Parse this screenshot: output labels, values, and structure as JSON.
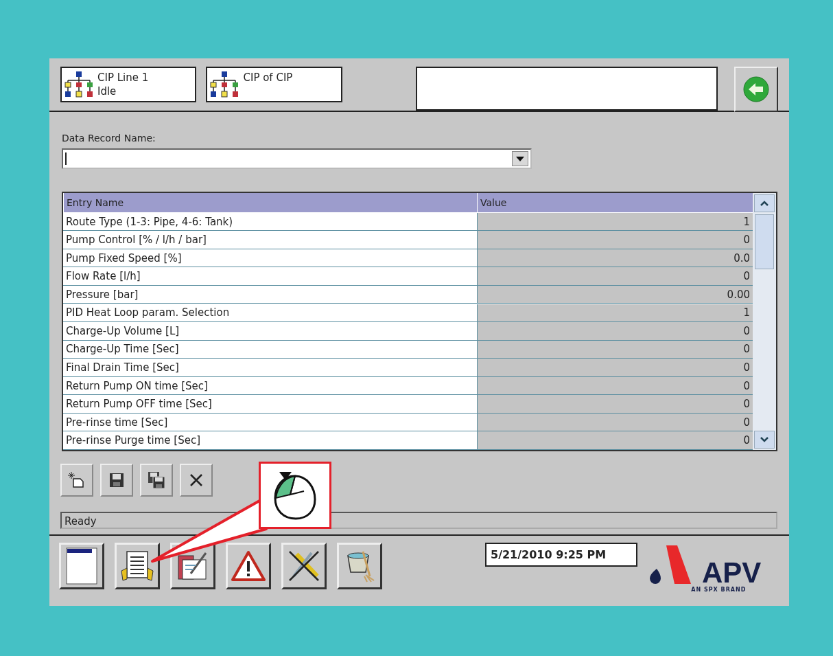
{
  "units": [
    {
      "title": "CIP Line 1",
      "status": "Idle"
    },
    {
      "title": "CIP of CIP"
    }
  ],
  "record": {
    "label": "Data Record Name:"
  },
  "table": {
    "columns": [
      "Entry Name",
      "Value"
    ],
    "rows": [
      {
        "entry": "Route Type (1-3: Pipe, 4-6: Tank)",
        "value": "1"
      },
      {
        "entry": "Pump Control [% / l/h / bar]",
        "value": "0"
      },
      {
        "entry": "Pump Fixed Speed [%]",
        "value": "0.0"
      },
      {
        "entry": "Flow Rate [l/h]",
        "value": "0"
      },
      {
        "entry": "Pressure [bar]",
        "value": "0.00"
      },
      {
        "entry": "PID Heat Loop param. Selection",
        "value": "1"
      },
      {
        "entry": "Charge-Up Volume [L]",
        "value": "0"
      },
      {
        "entry": "Charge-Up Time [Sec]",
        "value": "0"
      },
      {
        "entry": "Final Drain Time [Sec]",
        "value": "0"
      },
      {
        "entry": "Return Pump ON time [Sec]",
        "value": "0"
      },
      {
        "entry": "Return Pump OFF time [Sec]",
        "value": "0"
      },
      {
        "entry": "Pre-rinse time [Sec]",
        "value": "0"
      },
      {
        "entry": "Pre-rinse Purge time [Sec]",
        "value": "0"
      }
    ]
  },
  "status_bar": "Ready",
  "datetime": "5/21/2010 9:25 PM",
  "logo": {
    "name": "APV",
    "tagline": "AN SPX BRAND"
  }
}
